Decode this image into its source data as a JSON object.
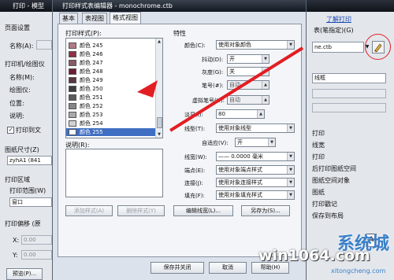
{
  "back_window": {
    "title": "打印 - 模型",
    "left": {
      "page_setup": "页面设置",
      "name_label": "名称(A):",
      "printer_label": "打印机/绘图仪",
      "name2_label": "名称(M):",
      "plotter_label": "绘图仪:",
      "location_label": "位置:",
      "desc_label": "说明:",
      "print_to_file": "打印到文",
      "paper_size": "图纸尺寸(Z)",
      "paper_value": "zyhA1 (841",
      "print_area": "打印区域",
      "print_range": "打印范围(W)",
      "range_value": "窗口",
      "print_offset": "打印偏移 (原",
      "x_label": "X:",
      "x_value": "0.00",
      "y_label": "Y:",
      "y_value": "0.00",
      "preview_button": "预览(P)..."
    },
    "right": {
      "learn_print": "了解打印",
      "style_table_label": "表(笔指定)(G)",
      "style_file": "ne.ctb",
      "shade_value": "线框",
      "opt1": "打印",
      "opt2": "线宽",
      "opt3": "打印",
      "opt4": "后打印图纸空间",
      "opt5": "图纸空间对象",
      "opt6": "图纸",
      "opt7": "打印戳记",
      "opt8": "保存到布局",
      "orient_label": "A"
    }
  },
  "editor": {
    "title": "打印样式表编辑器 - monochrome.ctb",
    "tabs": [
      "基本",
      "表视图",
      "格式视图"
    ],
    "active_tab": 2,
    "styles_label": "打印样式(P):",
    "styles": [
      {
        "name": "颜色 245",
        "color": "#b07a86"
      },
      {
        "name": "颜色 246",
        "color": "#8f3147"
      },
      {
        "name": "颜色 247",
        "color": "#8a5a66"
      },
      {
        "name": "颜色 248",
        "color": "#6e1d33"
      },
      {
        "name": "颜色 249",
        "color": "#5a3742"
      },
      {
        "name": "颜色 250",
        "color": "#3c3c3c"
      },
      {
        "name": "颜色 251",
        "color": "#5a5a5a"
      },
      {
        "name": "颜色 252",
        "color": "#868686"
      },
      {
        "name": "颜色 253",
        "color": "#aaaaaa"
      },
      {
        "name": "颜色 254",
        "color": "#d2d2d2"
      },
      {
        "name": "颜色 255",
        "color": "#ffffff"
      }
    ],
    "selected_style": 10,
    "desc_label": "说明(R):",
    "add_style": "添加样式(A)",
    "delete_style": "删除样式(Y)",
    "props_header": "特性",
    "props": {
      "color_label": "颜色(C):",
      "color_value": "使用对象颜色",
      "dither_label": "抖动(D):",
      "dither_value": "开",
      "grayscale_label": "灰度(G):",
      "grayscale_value": "关",
      "pen_label": "笔号(#):",
      "pen_value": "自动",
      "vpen_label": "虚拟笔号(U):",
      "vpen_value": "自动",
      "screen_label": "淡显(I):",
      "screen_value": "80",
      "linetype_label": "线型(T):",
      "linetype_value": "使用对象线型",
      "adaptive_label": "自适应(V):",
      "adaptive_value": "开",
      "lineweight_label": "线宽(W):",
      "lineweight_value": "—— 0.0000 毫米",
      "endstyle_label": "端点(E):",
      "endstyle_value": "使用对象端点样式",
      "joinstyle_label": "连接(J):",
      "joinstyle_value": "使用对象连接样式",
      "fillstyle_label": "填充(F):",
      "fillstyle_value": "使用对象填充样式"
    },
    "edit_lineweights": "编辑线宽(L)...",
    "save_as": "另存为(S)...",
    "save_close": "保存并关闭",
    "cancel": "取消",
    "help": "帮助(H)"
  },
  "watermark": {
    "site": "win1064.com",
    "brand": "系统城",
    "url": "xitongcheng.com"
  },
  "accent": "#e21e23"
}
